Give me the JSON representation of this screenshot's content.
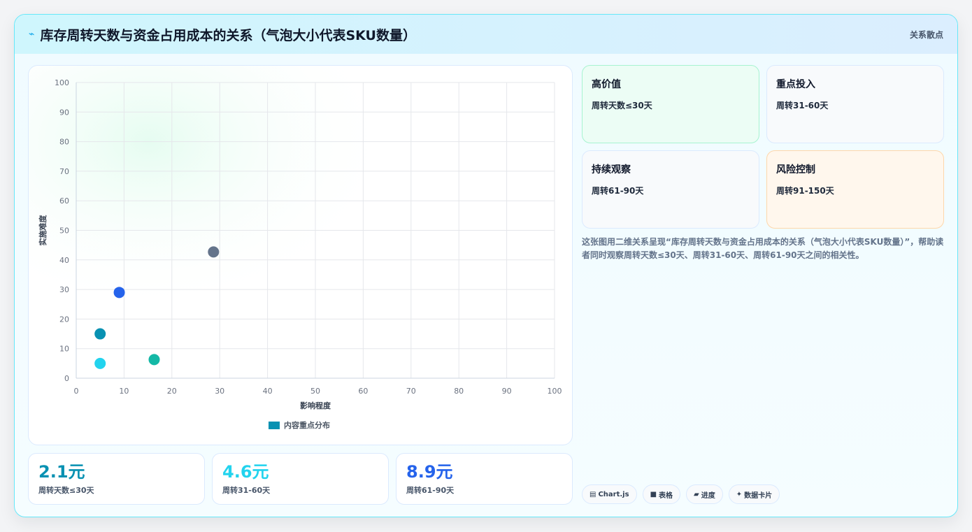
{
  "header": {
    "title": "库存周转天数与资金占用成本的关系（气泡大小代表SKU数量）",
    "tag": "关系散点"
  },
  "chart_data": {
    "type": "scatter",
    "xlabel": "影响程度",
    "ylabel": "实施难度",
    "xlim": [
      0,
      100
    ],
    "ylim": [
      0,
      100
    ],
    "xticks": [
      0,
      10,
      20,
      30,
      40,
      50,
      60,
      70,
      80,
      90,
      100
    ],
    "yticks": [
      0,
      10,
      20,
      30,
      40,
      50,
      60,
      70,
      80,
      90,
      100
    ],
    "grid": true,
    "legend_position": "bottom",
    "series": [
      {
        "name": "内容重点分布",
        "legend_color": "#0891b2",
        "points": [
          {
            "x": 5,
            "y": 15,
            "color": "#0891b2"
          },
          {
            "x": 5,
            "y": 5,
            "color": "#22d3ee"
          },
          {
            "x": 9,
            "y": 29,
            "color": "#2563eb"
          },
          {
            "x": 16.3,
            "y": 6.3,
            "color": "#14b8a6"
          },
          {
            "x": 28.7,
            "y": 42.7,
            "color": "#64748b"
          }
        ]
      }
    ]
  },
  "stats": [
    {
      "value": "2.1元",
      "label": "周转天数≤30天",
      "color": "#0891b2"
    },
    {
      "value": "4.6元",
      "label": "周转31-60天",
      "color": "#22d3ee"
    },
    {
      "value": "8.9元",
      "label": "周转61-90天",
      "color": "#2563eb"
    }
  ],
  "quadrants": [
    {
      "title": "高价值",
      "sub": "周转天数≤30天",
      "bg": "#ecfdf5",
      "border": "#a7f3d0"
    },
    {
      "title": "重点投入",
      "sub": "周转31-60天",
      "bg": "#f8fafc",
      "border": "#dbeafe"
    },
    {
      "title": "持续观察",
      "sub": "周转61-90天",
      "bg": "#f8fafc",
      "border": "#dbeafe"
    },
    {
      "title": "风险控制",
      "sub": "周转91-150天",
      "bg": "#fff7ed",
      "border": "#fed7aa"
    }
  ],
  "description": "这张图用二维关系呈现“库存周转天数与资金占用成本的关系（气泡大小代表SKU数量）”，帮助读者同时观察周转天数≤30天、周转31-60天、周转61-90天之间的相关性。",
  "chips": [
    {
      "icon": "chart-icon",
      "glyph": "▤",
      "label": "Chart.js"
    },
    {
      "icon": "table-icon",
      "glyph": "■",
      "label": "表格"
    },
    {
      "icon": "progress-icon",
      "glyph": "▰",
      "label": "进度"
    },
    {
      "icon": "card-icon",
      "glyph": "✦",
      "label": "数据卡片"
    }
  ]
}
